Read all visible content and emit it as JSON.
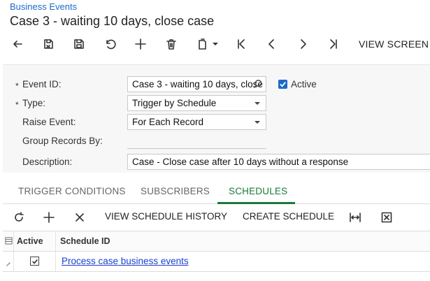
{
  "breadcrumb": "Business Events",
  "title": "Case 3 - waiting 10 days, close case",
  "toolbar": {
    "buttons": [
      "back-icon",
      "save-close-icon",
      "save-icon",
      "undo-icon",
      "add-icon",
      "delete-icon",
      "copy-paste-icon",
      "first-icon",
      "previous-icon",
      "next-icon",
      "last-icon"
    ],
    "view_screen": "VIEW SCREEN"
  },
  "form": {
    "event_id": {
      "label": "Event ID:",
      "required": "*",
      "value": "Case 3 - waiting 10 days, close case"
    },
    "active": {
      "label": "Active",
      "checked": true
    },
    "type": {
      "label": "Type:",
      "required": "*",
      "value": "Trigger by Schedule"
    },
    "raise_event": {
      "label": "Raise Event:",
      "value": "For Each Record"
    },
    "group_records_by": {
      "label": "Group Records By:",
      "value": ""
    },
    "description": {
      "label": "Description:",
      "value": "Case - Close case after 10 days without a response"
    }
  },
  "tabs": [
    {
      "label": "TRIGGER CONDITIONS",
      "active": false
    },
    {
      "label": "SUBSCRIBERS",
      "active": false
    },
    {
      "label": "SCHEDULES",
      "active": true
    }
  ],
  "grid_toolbar": {
    "view_schedule_history": "VIEW SCHEDULE HISTORY",
    "create_schedule": "CREATE SCHEDULE"
  },
  "grid": {
    "columns": [
      "Active",
      "Schedule ID"
    ],
    "rows": [
      {
        "active": true,
        "schedule_id": "Process case business events"
      }
    ]
  },
  "colors": {
    "accent": "#1b6ac9",
    "active_tab": "#1a7a3a",
    "link": "#1b3fcf"
  }
}
